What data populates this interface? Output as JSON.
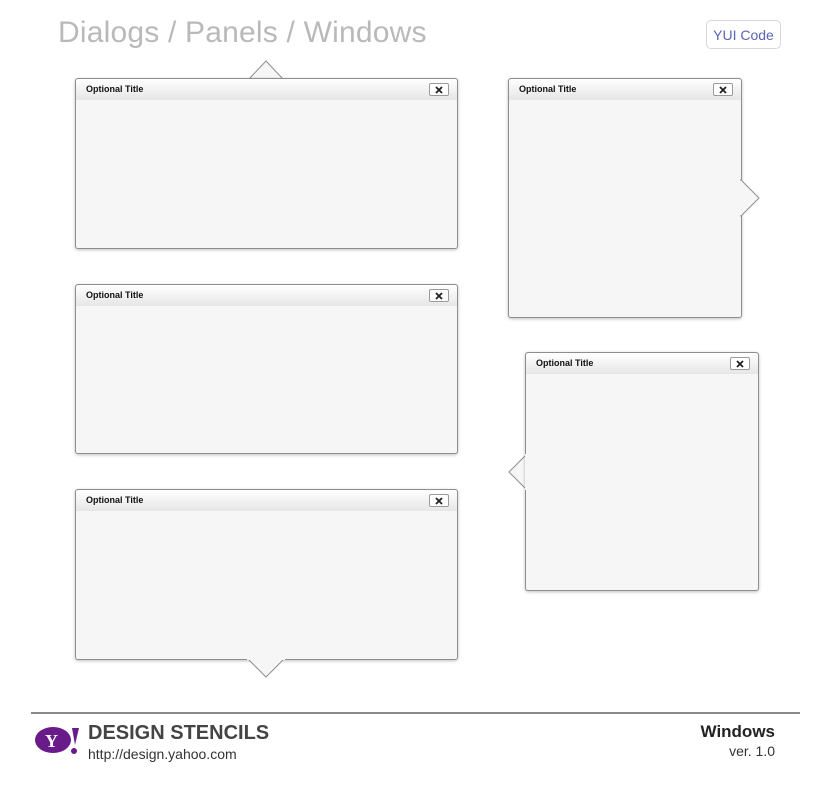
{
  "header": {
    "title": "Dialogs / Panels / Windows",
    "yui_button_label": "YUI Code"
  },
  "panels": [
    {
      "title": "Optional Title",
      "pointer": "top"
    },
    {
      "title": "Optional Title",
      "pointer": "none"
    },
    {
      "title": "Optional Title",
      "pointer": "bottom"
    },
    {
      "title": "Optional Title",
      "pointer": "right"
    },
    {
      "title": "Optional Title",
      "pointer": "left"
    }
  ],
  "icons": {
    "close": "close-icon",
    "logo": "yahoo-logo-icon"
  },
  "footer": {
    "brand_logo_text": "Y!",
    "brand_title": "DESIGN STENCILS",
    "brand_url": "http://design.yahoo.com",
    "doc_name": "Windows",
    "doc_version": "ver. 1.0"
  },
  "colors": {
    "panel_bg": "#f6f6f6",
    "panel_border": "#8e8e8e",
    "title_gray": "#b9b9b9",
    "link_blue": "#5b63b3",
    "yahoo_purple": "#6a1b8a"
  }
}
